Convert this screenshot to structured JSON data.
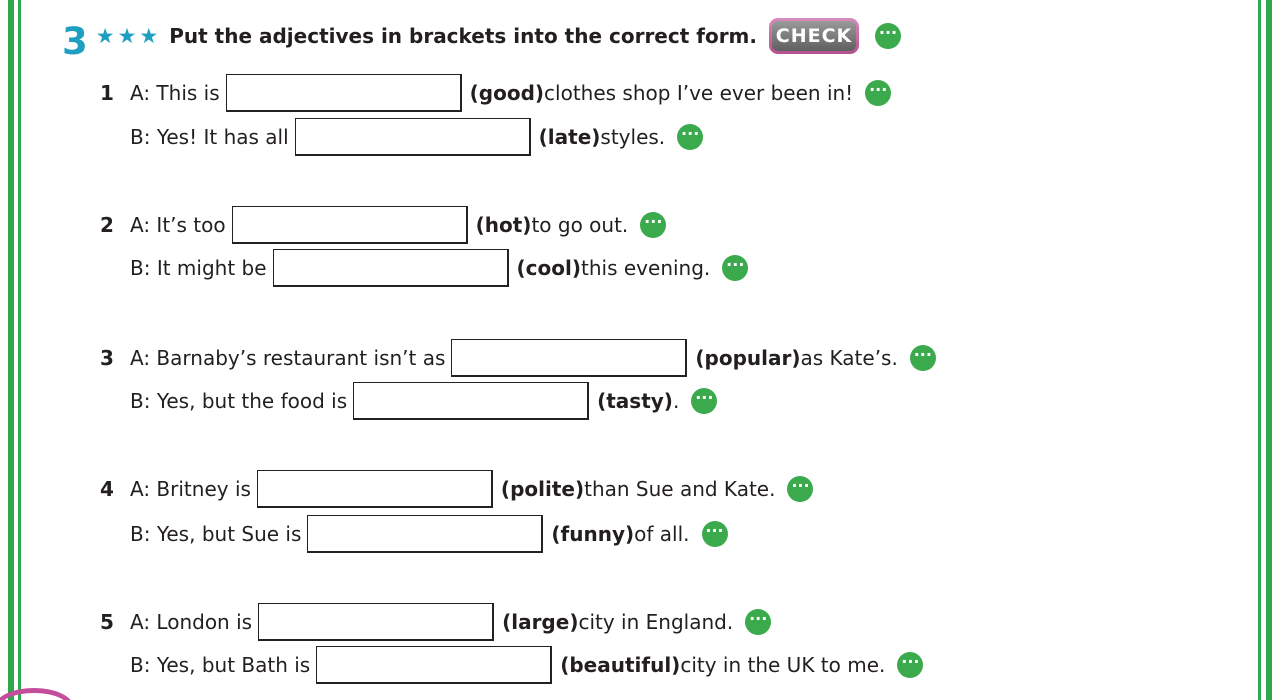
{
  "exercise": {
    "number": "3",
    "stars": "★★★",
    "instruction": "Put the adjectives in brackets into the correct form.",
    "check_label": "CHECK",
    "dots": "···"
  },
  "items": [
    {
      "number": "1",
      "a": {
        "pre": "A: This is",
        "hint": "(good)",
        "post": " clothes shop I’ve ever been in!",
        "value": ""
      },
      "b": {
        "pre": "B: Yes! It has all",
        "hint": "(late)",
        "post": " styles.",
        "value": ""
      }
    },
    {
      "number": "2",
      "a": {
        "pre": "A: It’s too",
        "hint": "(hot)",
        "post": " to go out.",
        "value": ""
      },
      "b": {
        "pre": "B: It might be",
        "hint": "(cool)",
        "post": " this evening.",
        "value": ""
      }
    },
    {
      "number": "3",
      "a": {
        "pre": "A: Barnaby’s restaurant isn’t as",
        "hint": "(popular)",
        "post": " as Kate’s.",
        "value": ""
      },
      "b": {
        "pre": "B: Yes, but the food is",
        "hint": "(tasty)",
        "post": ".",
        "value": ""
      }
    },
    {
      "number": "4",
      "a": {
        "pre": "A: Britney is",
        "hint": "(polite)",
        "post": " than Sue and Kate.",
        "value": ""
      },
      "b": {
        "pre": "B: Yes, but Sue is",
        "hint": "(funny)",
        "post": " of all.",
        "value": ""
      }
    },
    {
      "number": "5",
      "a": {
        "pre": "A: London is",
        "hint": "(large)",
        "post": " city in England.",
        "value": ""
      },
      "b": {
        "pre": "B: Yes, but Bath is",
        "hint": "(beautiful)",
        "post": " city in the UK to me.",
        "value": ""
      }
    }
  ],
  "colors": {
    "frame_green": "#2da84a",
    "accent_blue": "#1e9fc1",
    "icon_green": "#3aaa4c",
    "check_border_pink": "#c44d9c"
  }
}
